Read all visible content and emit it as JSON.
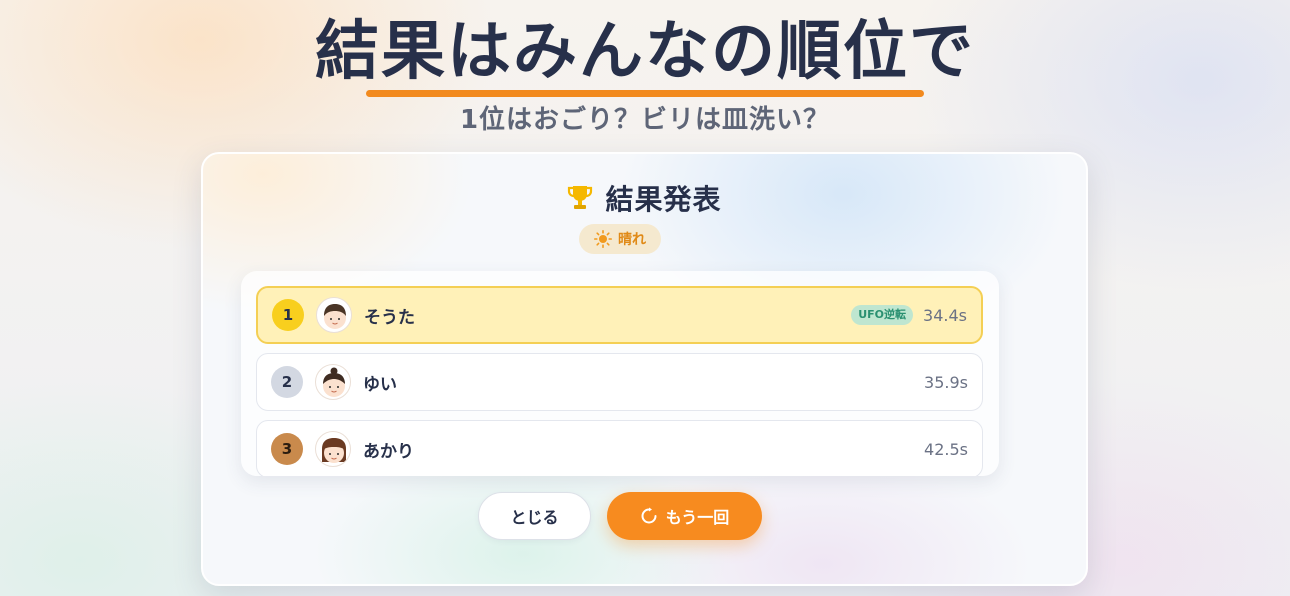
{
  "header": {
    "title": "結果はみんなの順位で",
    "subtitle": "1位はおごり？ビリは皿洗い？"
  },
  "card": {
    "title": "結果発表",
    "title_icon": "trophy-icon",
    "weather": {
      "icon": "sun-icon",
      "label": "晴れ"
    }
  },
  "results": [
    {
      "rank": "1",
      "name": "そうた",
      "badge": "UFO逆転",
      "time": "34.4s"
    },
    {
      "rank": "2",
      "name": "ゆい",
      "time": "35.9s"
    },
    {
      "rank": "3",
      "name": "あかり",
      "time": "42.5s"
    }
  ],
  "buttons": {
    "close_label": "とじる",
    "retry_label": "もう一回",
    "retry_icon": "refresh-icon"
  },
  "colors": {
    "accent": "#f78b1f",
    "title_text": "#27304a",
    "gold": "#f8cf1e",
    "silver": "#d3d8e2",
    "bronze": "#c98a4c",
    "highlight_row": "#fff1b8",
    "weather_text": "#e08a17",
    "ufo_badge": "#bfe6d0"
  }
}
